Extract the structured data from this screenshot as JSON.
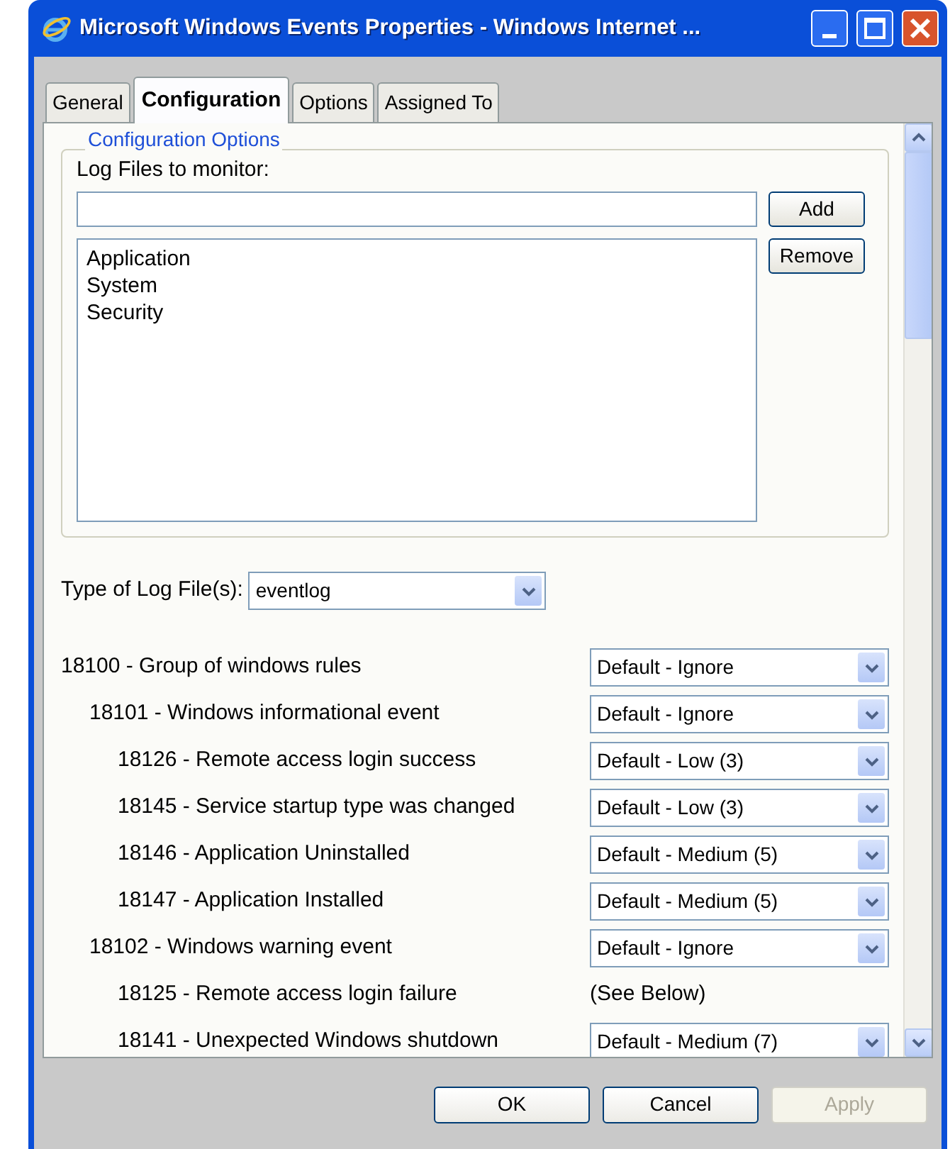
{
  "window": {
    "title": "Microsoft Windows Events Properties - Windows Internet ..."
  },
  "tabs": [
    {
      "label": "General",
      "selected": false
    },
    {
      "label": "Configuration",
      "selected": true
    },
    {
      "label": "Options",
      "selected": false
    },
    {
      "label": "Assigned To",
      "selected": false
    }
  ],
  "fieldset": {
    "legend": "Configuration Options"
  },
  "log_files": {
    "label": "Log Files to monitor:",
    "add_button": "Add",
    "remove_button": "Remove",
    "items": [
      "Application",
      "System",
      "Security"
    ]
  },
  "log_type": {
    "label": "Type of Log File(s):",
    "value": "eventlog"
  },
  "rules": [
    {
      "label": "18100 - Group of windows rules",
      "kind": "select",
      "value": "Default - Ignore",
      "children": [
        {
          "label": "18101 - Windows informational event",
          "kind": "select",
          "value": "Default - Ignore",
          "children": [
            {
              "label": "18126 - Remote access login success",
              "kind": "select",
              "value": "Default - Low (3)"
            },
            {
              "label": "18145 - Service startup type was changed",
              "kind": "select",
              "value": "Default - Low (3)"
            },
            {
              "label": "18146 - Application Uninstalled",
              "kind": "select",
              "value": "Default - Medium (5)"
            },
            {
              "label": "18147 - Application Installed",
              "kind": "select",
              "value": "Default - Medium (5)"
            }
          ]
        },
        {
          "label": "18102 - Windows warning event",
          "kind": "select",
          "value": "Default - Ignore",
          "children": [
            {
              "label": "18125 - Remote access login failure",
              "kind": "text",
              "value": "(See Below)"
            },
            {
              "label": "18141 - Unexpected Windows shutdown",
              "kind": "select",
              "value": "Default - Medium (7)"
            }
          ]
        }
      ]
    }
  ],
  "buttons": [
    {
      "label": "OK",
      "disabled": false
    },
    {
      "label": "Cancel",
      "disabled": false
    },
    {
      "label": "Apply",
      "disabled": true
    }
  ]
}
